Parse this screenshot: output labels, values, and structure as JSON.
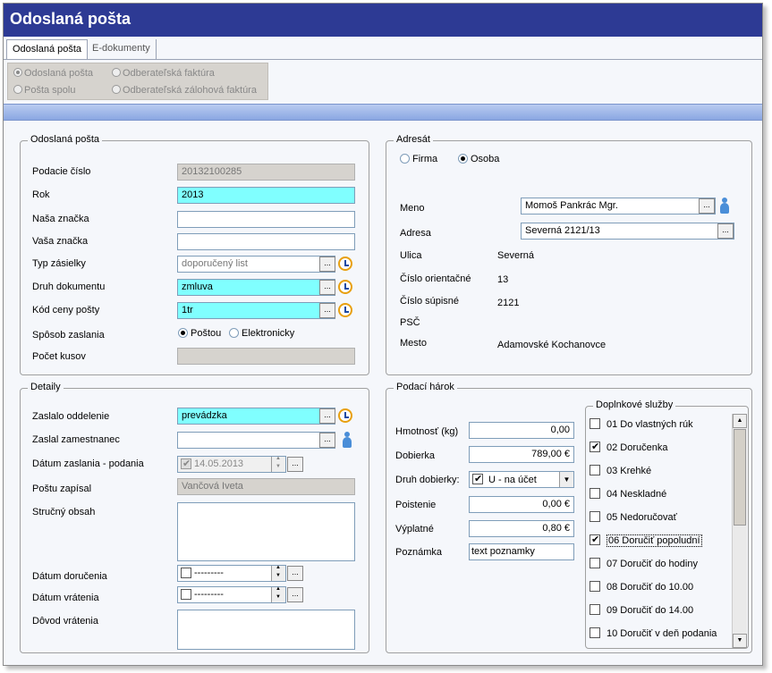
{
  "window": {
    "title": "Odoslaná pošta"
  },
  "tabs": [
    {
      "label": "Odoslaná pošta",
      "active": true
    },
    {
      "label": "E-dokumenty",
      "active": false
    }
  ],
  "filter_radios": [
    {
      "label": "Odoslaná pošta",
      "selected": true
    },
    {
      "label": "Odberateľská faktúra",
      "selected": false
    },
    {
      "label": "Pošta spolu",
      "selected": false
    },
    {
      "label": "Odberateľská zálohová faktúra",
      "selected": false
    }
  ],
  "odoslana_posta": {
    "legend": "Odoslaná pošta",
    "podacie_cislo": {
      "label": "Podacie číslo",
      "value": "20132100285"
    },
    "rok": {
      "label": "Rok",
      "value": "2013"
    },
    "nasa_znacka": {
      "label": "Naša značka",
      "value": ""
    },
    "vasa_znacka": {
      "label": "Vaša značka",
      "value": ""
    },
    "typ_zasielky": {
      "label": "Typ zásielky",
      "value": "doporučený list"
    },
    "druh_dokumentu": {
      "label": "Druh dokumentu",
      "value": "zmluva"
    },
    "kod_ceny": {
      "label": "Kód ceny pošty",
      "value": "1tr"
    },
    "sposob": {
      "label": "Spôsob zaslania",
      "opt1": "Poštou",
      "opt2": "Elektronicky",
      "selected": "Poštou"
    },
    "pocet_kusov": {
      "label": "Počet kusov",
      "value": ""
    }
  },
  "adresat": {
    "legend": "Adresát",
    "firma": "Firma",
    "osoba": "Osoba",
    "selected": "Osoba",
    "meno": {
      "label": "Meno",
      "value": "Momoš Pankrác Mgr."
    },
    "adresa": {
      "label": "Adresa",
      "value": "Severná 2121/13"
    },
    "ulica": {
      "label": "Ulica",
      "value": "Severná"
    },
    "cislo_orientacne": {
      "label": "Číslo orientačné",
      "value": "13"
    },
    "cislo_supisne": {
      "label": "Číslo súpisné",
      "value": "2121"
    },
    "psc": {
      "label": "PSČ",
      "value": ""
    },
    "mesto": {
      "label": "Mesto",
      "value": "Adamovské Kochanovce"
    }
  },
  "detaily": {
    "legend": "Detaily",
    "zaslalo_oddelenie": {
      "label": "Zaslalo oddelenie",
      "value": "prevádzka"
    },
    "zaslal_zamestnanec": {
      "label": "Zaslal zamestnanec",
      "value": ""
    },
    "datum_zaslania": {
      "label": "Dátum zaslania - podania",
      "value": "14.05.2013",
      "checked": true
    },
    "postu_zapisal": {
      "label": "Poštu zapísal",
      "value": "Vančová Iveta"
    },
    "strucny_obsah": {
      "label": "Stručný obsah",
      "value": ""
    },
    "datum_dorucenia": {
      "label": "Dátum doručenia",
      "value": "---------",
      "checked": false
    },
    "datum_vratenia": {
      "label": "Dátum vrátenia",
      "value": "---------",
      "checked": false
    },
    "dovod_vratenia": {
      "label": "Dôvod vrátenia",
      "value": ""
    }
  },
  "podaci_harok": {
    "legend": "Podací hárok",
    "hmotnost": {
      "label": "Hmotnosť (kg)",
      "value": "0,00"
    },
    "dobierka": {
      "label": "Dobierka",
      "value": "789,00 €"
    },
    "druh_dobierky": {
      "label": "Druh dobierky:",
      "value": "U - na účet",
      "checked": true
    },
    "poistenie": {
      "label": "Poistenie",
      "value": "0,00 €"
    },
    "vyplatne": {
      "label": "Výplatné",
      "value": "0,80 €"
    },
    "poznamka": {
      "label": "Poznámka",
      "value": "text poznamky"
    }
  },
  "doplnkove_sluzby": {
    "legend": "Doplnkové služby",
    "items": [
      {
        "label": "01 Do vlastných rúk",
        "checked": false
      },
      {
        "label": "02 Doručenka",
        "checked": true
      },
      {
        "label": "03 Krehké",
        "checked": false
      },
      {
        "label": "04 Neskladné",
        "checked": false
      },
      {
        "label": "05 Nedoručovať",
        "checked": false
      },
      {
        "label": "06 Doručiť popoludní",
        "checked": true
      },
      {
        "label": "07 Doručiť do hodiny",
        "checked": false
      },
      {
        "label": "08 Doručiť do 10.00",
        "checked": false
      },
      {
        "label": "09 Doručiť do 14.00",
        "checked": false
      },
      {
        "label": "10 Doručiť v deň podania",
        "checked": false
      }
    ]
  },
  "icons": {
    "browse": "ellipsis-button",
    "history": "clock-icon",
    "contact": "person-icon"
  }
}
